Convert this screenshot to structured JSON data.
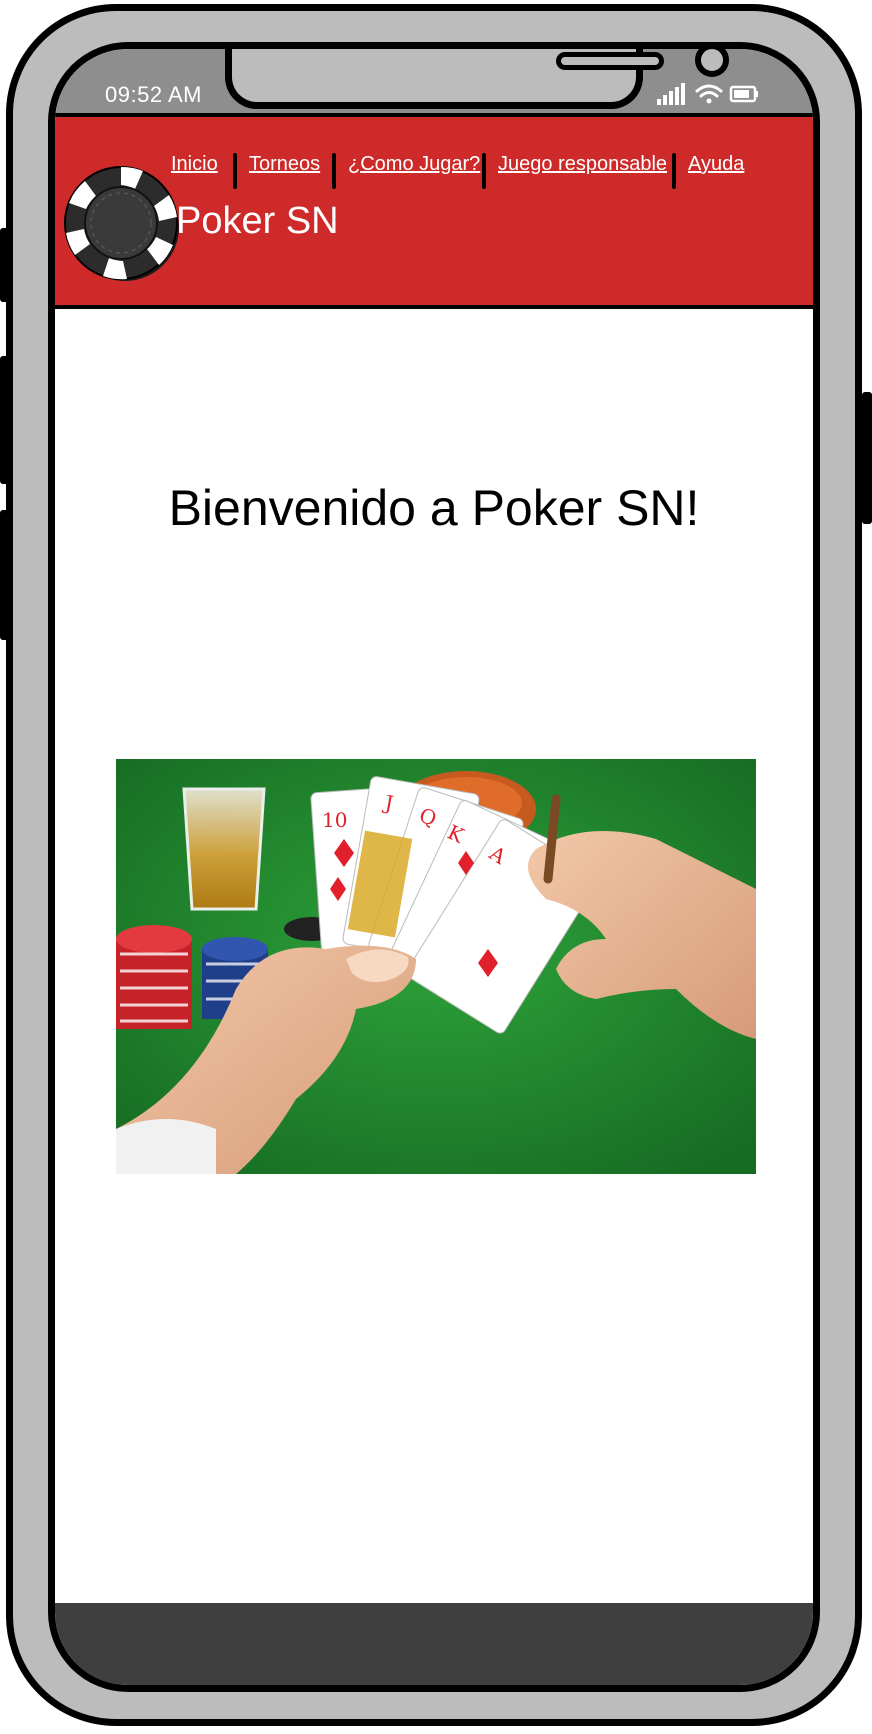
{
  "status_bar": {
    "time": "09:52 AM",
    "icons": [
      "signal-icon",
      "wifi-icon",
      "battery-icon"
    ]
  },
  "header": {
    "logo": "poker-chip-logo",
    "brand": "Poker SN",
    "nav": [
      "Inicio",
      "Torneos",
      "¿Como Jugar?",
      "Juego responsable",
      "Ayuda"
    ]
  },
  "main": {
    "welcome": "Bienvenido a Poker SN!",
    "hero_image": "poker-hand-photo"
  },
  "colors": {
    "header_bg": "#cf2a2a",
    "text": "#000000",
    "nav_text": "#ffffff",
    "phone_frame": "#bcbcbc",
    "bottom_bar": "#3f3f3f",
    "felt": "#1f8a2e"
  }
}
